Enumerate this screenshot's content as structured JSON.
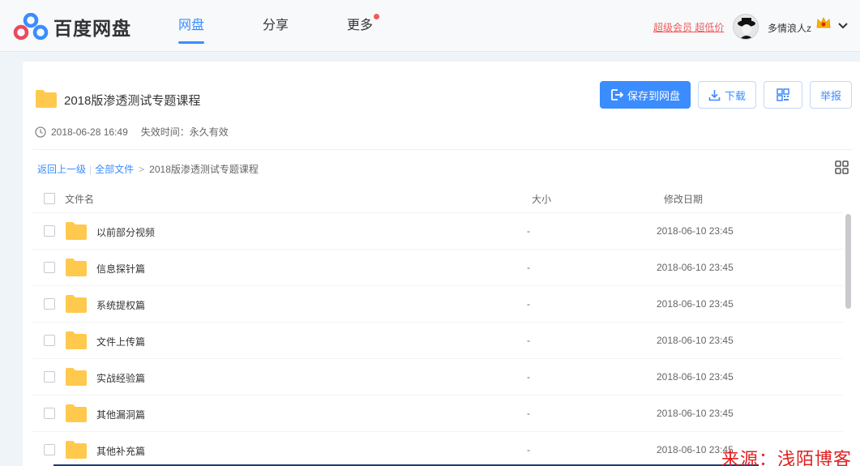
{
  "header": {
    "logo_text": "百度网盘",
    "nav": [
      {
        "label": "网盘",
        "active": true
      },
      {
        "label": "分享",
        "active": false
      },
      {
        "label": "更多",
        "active": false,
        "has_dot": true
      }
    ],
    "vip_link": "超级会员 超低价",
    "username": "多情浪人z"
  },
  "share": {
    "title": "2018版渗透测试专题课程",
    "created": "2018-06-28 16:49",
    "expire": "失效时间：永久有效"
  },
  "actions": {
    "save": "保存到网盘",
    "download": "下载",
    "report": "举报"
  },
  "breadcrumb": {
    "back": "返回上一级",
    "all": "全部文件",
    "current": "2018版渗透测试专题课程"
  },
  "columns": {
    "name": "文件名",
    "size": "大小",
    "date": "修改日期"
  },
  "files": [
    {
      "name": "以前部分视频",
      "size": "-",
      "date": "2018-06-10 23:45"
    },
    {
      "name": "信息探针篇",
      "size": "-",
      "date": "2018-06-10 23:45"
    },
    {
      "name": "系统提权篇",
      "size": "-",
      "date": "2018-06-10 23:45"
    },
    {
      "name": "文件上传篇",
      "size": "-",
      "date": "2018-06-10 23:45"
    },
    {
      "name": "实战经验篇",
      "size": "-",
      "date": "2018-06-10 23:45"
    },
    {
      "name": "其他漏洞篇",
      "size": "-",
      "date": "2018-06-10 23:45"
    },
    {
      "name": "其他补充篇",
      "size": "-",
      "date": "2018-06-10 23:45"
    }
  ],
  "watermark": "来源：浅陌博客",
  "colors": {
    "accent": "#3b8cff",
    "vip": "#f25a5a",
    "folder": "#ffc94d"
  },
  "icons": [
    "baidu-logo-icon",
    "clock-icon",
    "folder-icon",
    "save-icon",
    "download-icon",
    "qrcode-icon",
    "grid-view-icon",
    "chevron-down-icon",
    "crown-icon"
  ]
}
